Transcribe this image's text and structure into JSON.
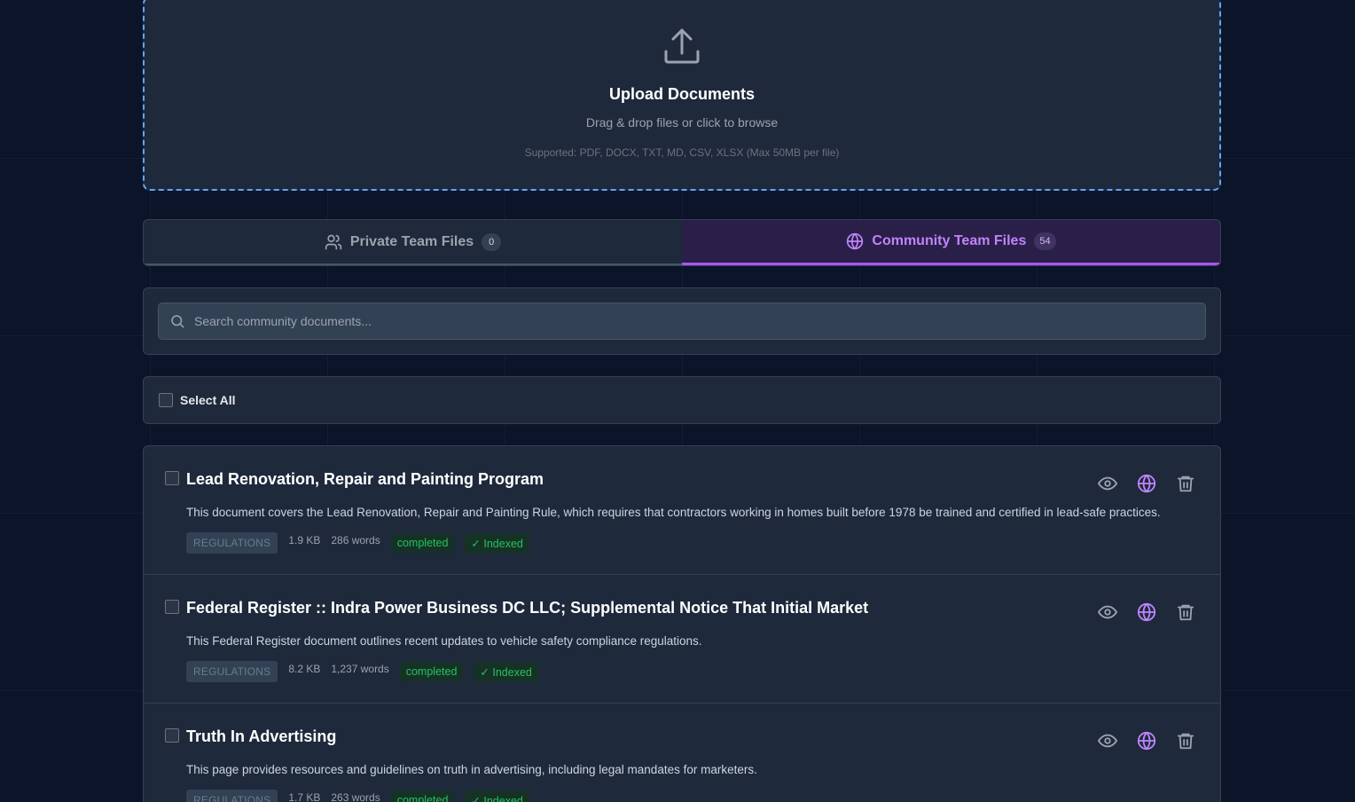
{
  "upload": {
    "title": "Upload Documents",
    "subtitle": "Drag & drop files or click to browse",
    "supported": "Supported: PDF, DOCX, TXT, MD, CSV, XLSX (Max 50MB per file)",
    "icon": "upload-icon"
  },
  "tabs": [
    {
      "label": "Private Team Files",
      "count": "0",
      "icon": "users-icon",
      "active": false
    },
    {
      "label": "Community Team Files",
      "count": "54",
      "icon": "globe-icon",
      "active": true
    }
  ],
  "search": {
    "placeholder": "Search community documents...",
    "value": ""
  },
  "select_all": {
    "label": "Select All",
    "checked": false
  },
  "documents": [
    {
      "title": "Lead Renovation, Repair and Painting Program",
      "description": "This document covers the Lead Renovation, Repair and Painting Rule, which requires that contractors working in homes built before 1978 be trained and certified in lead-safe practices.",
      "category": "REGULATIONS",
      "size": "1.9 KB",
      "words": "286 words",
      "status": "completed",
      "indexed": "✓ Indexed"
    },
    {
      "title": "Federal Register :: Indra Power Business DC LLC; Supplemental Notice That Initial Market",
      "description": "This Federal Register document outlines recent updates to vehicle safety compliance regulations.",
      "category": "REGULATIONS",
      "size": "8.2 KB",
      "words": "1,237 words",
      "status": "completed",
      "indexed": "✓ Indexed"
    },
    {
      "title": "Truth In Advertising",
      "description": "This page provides resources and guidelines on truth in advertising, including legal mandates for marketers.",
      "category": "REGULATIONS",
      "size": "1.7 KB",
      "words": "263 words",
      "status": "completed",
      "indexed": "✓ Indexed"
    }
  ],
  "colors": {
    "background": "#0b1429",
    "panel": "#1e293b",
    "accent_purple": "#a855f7",
    "upload_border": "#60a5fa",
    "status_green": "#22c55e"
  }
}
